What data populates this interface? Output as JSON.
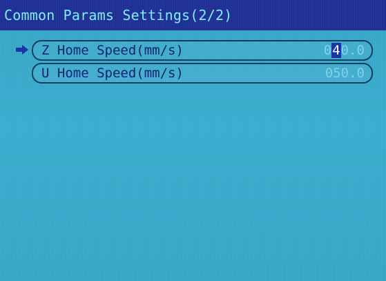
{
  "header": {
    "title": "Common Params Settings(2/2)"
  },
  "params": [
    {
      "label": "Z Home Speed(mm/s)",
      "value_prefix": "0",
      "value_cursor": "4",
      "value_suffix": "0.0",
      "selected": true
    },
    {
      "label": "U Home Speed(mm/s)",
      "value": "050.0",
      "selected": false
    }
  ],
  "colors": {
    "title_bar": "#1e2f96",
    "title_text": "#7ff0ff",
    "screen_bg": "#3aaed0",
    "label_text": "#0c1f6e",
    "value_text": "#7fd3ea",
    "cursor_bg": "#1a2fa6"
  },
  "icons": {
    "selection": "arrow-right-icon"
  }
}
